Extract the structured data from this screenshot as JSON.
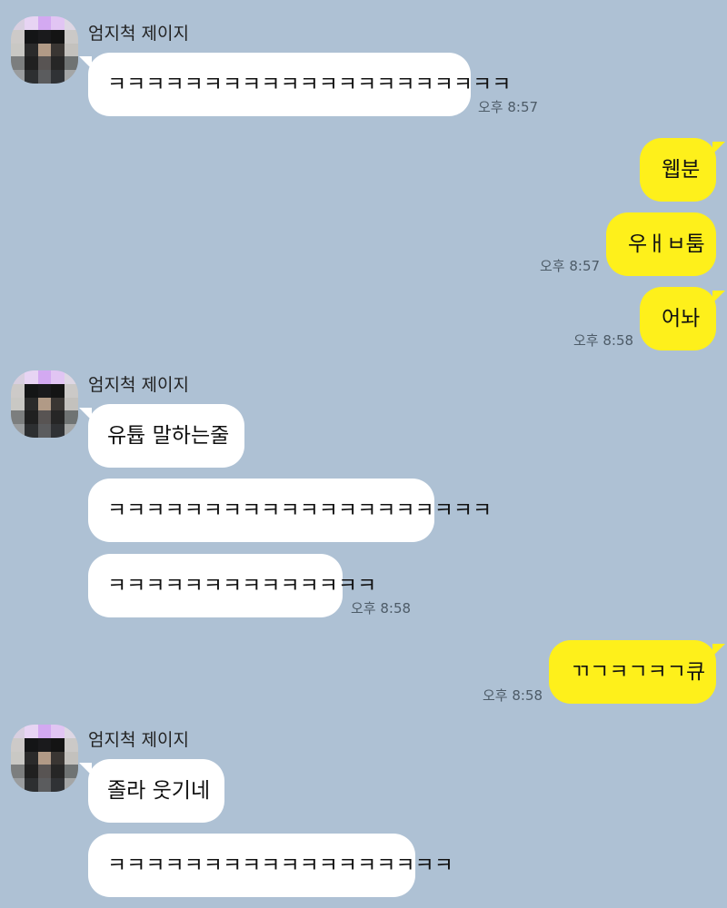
{
  "colors": {
    "background": "#aec1d4",
    "received_bubble": "#ffffff",
    "sent_bubble": "#fef01b",
    "timestamp": "#4d5b67"
  },
  "contact": {
    "name": "엄지척 제이지",
    "avatar_icon": "pixelated-profile-avatar"
  },
  "messages": [
    {
      "from": "other",
      "text": "ㅋㅋㅋㅋㅋㅋㅋㅋㅋㅋㅋㅋㅋㅋㅋㅋㅋㅋㅋㅋㅋ",
      "time": "오후 8:57"
    },
    {
      "from": "me",
      "text": "웹분"
    },
    {
      "from": "me",
      "text": "우ㅐㅂ툼",
      "time": "오후 8:57"
    },
    {
      "from": "me",
      "text": "어놔",
      "time": "오후 8:58"
    },
    {
      "from": "other",
      "text": "유튭 말하는줄"
    },
    {
      "from": "other",
      "text": "ㅋㅋㅋㅋㅋㅋㅋㅋㅋㅋㅋㅋㅋㅋㅋㅋㅋㅋㅋㅋ"
    },
    {
      "from": "other",
      "text": "ㅋㅋㅋㅋㅋㅋㅋㅋㅋㅋㅋㅋㅋㅋ",
      "time": "오후 8:58"
    },
    {
      "from": "me",
      "text": "ㄲㄱㅋㄱㅋㄱ큐",
      "time": "오후 8:58"
    },
    {
      "from": "other",
      "text": "졸라 웃기네"
    },
    {
      "from": "other",
      "text": "ㅋㅋㅋㅋㅋㅋㅋㅋㅋㅋㅋㅋㅋㅋㅋㅋㅋㅋ"
    }
  ]
}
